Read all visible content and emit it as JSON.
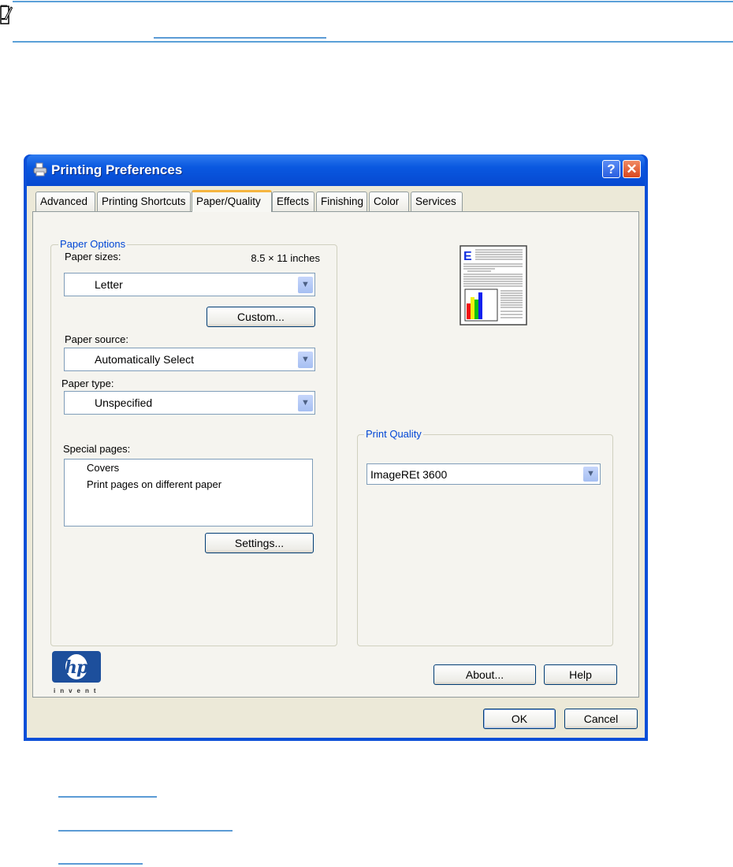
{
  "note": {
    "icon": "note-pencil-icon"
  },
  "dialog": {
    "title": "Printing Preferences",
    "help_button": "?",
    "close_button": "✕",
    "tabs": [
      {
        "label": "Advanced"
      },
      {
        "label": "Printing Shortcuts"
      },
      {
        "label": "Paper/Quality",
        "selected": true
      },
      {
        "label": "Effects"
      },
      {
        "label": "Finishing"
      },
      {
        "label": "Color"
      },
      {
        "label": "Services"
      }
    ],
    "paper_options": {
      "group_label": "Paper Options",
      "paper_sizes_label": "Paper sizes:",
      "paper_size_dims": "8.5 × 11 inches",
      "paper_size_value": "Letter",
      "custom_button": "Custom...",
      "paper_source_label": "Paper source:",
      "paper_source_value": "Automatically Select",
      "paper_type_label": "Paper type:",
      "paper_type_value": "Unspecified",
      "special_pages_label": "Special pages:",
      "special_pages": [
        "Covers",
        "Print pages on different paper"
      ],
      "settings_button": "Settings..."
    },
    "print_quality": {
      "group_label": "Print Quality",
      "value": "ImageREt 3600"
    },
    "logo": {
      "text": "hp",
      "tagline": "invent"
    },
    "about_button": "About...",
    "help_label": "Help",
    "ok_button": "OK",
    "cancel_button": "Cancel",
    "colors": {
      "accent": "#0046d5",
      "titlebar": "#0a58e0",
      "close": "#e2512a"
    }
  }
}
